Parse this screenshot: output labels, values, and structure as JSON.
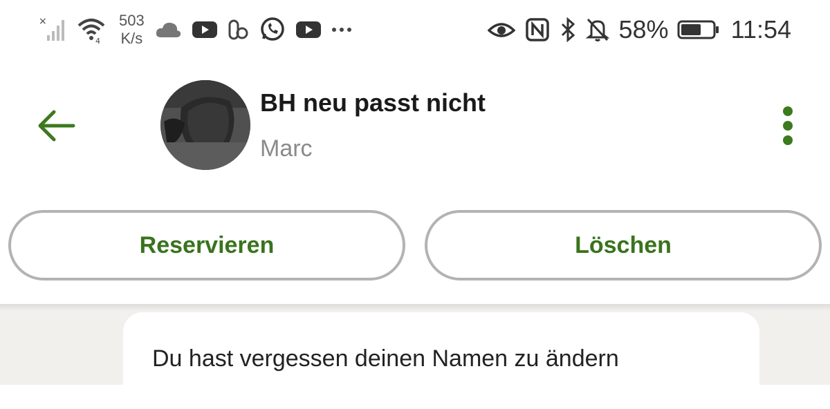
{
  "status_bar": {
    "net_speed_value": "503",
    "net_speed_unit": "K/s",
    "battery_percent": "58%",
    "time": "11:54",
    "icons_left": [
      "no-signal-icon",
      "wifi-icon",
      "cloud-icon",
      "youtube-icon",
      "app-icon",
      "whatsapp-icon",
      "youtube-icon",
      "more-icon"
    ],
    "icons_right": [
      "eye-icon",
      "nfc-icon",
      "bluetooth-icon",
      "bell-off-icon",
      "battery-icon"
    ]
  },
  "header": {
    "title": "BH neu passt nicht",
    "subtitle": "Marc",
    "accent_color": "#3c7a1e"
  },
  "actions": {
    "reserve_label": "Reservieren",
    "delete_label": "Löschen"
  },
  "chat": {
    "message": "Du hast vergessen deinen Namen zu ändern"
  }
}
